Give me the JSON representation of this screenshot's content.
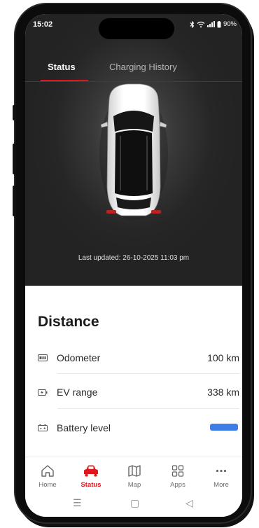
{
  "status_bar": {
    "time": "15:02",
    "battery": "90%"
  },
  "tabs": [
    {
      "label": "Status",
      "active": true
    },
    {
      "label": "Charging History",
      "active": false
    }
  ],
  "car_image": "car-top-view",
  "last_updated": "Last updated: 26-10-2025 11:03 pm",
  "distance": {
    "title": "Distance",
    "rows": [
      {
        "icon": "odometer-icon",
        "label": "Odometer",
        "value": "100 km"
      },
      {
        "icon": "ev-range-icon",
        "label": "EV range",
        "value": "338 km"
      },
      {
        "icon": "battery-icon",
        "label": "Battery level",
        "value": ""
      }
    ]
  },
  "battery_level_fill": 1.0,
  "bottom_nav": [
    {
      "label": "Home",
      "icon": "home-icon",
      "active": false
    },
    {
      "label": "Status",
      "icon": "car-icon",
      "active": true
    },
    {
      "label": "Map",
      "icon": "map-icon",
      "active": false
    },
    {
      "label": "Apps",
      "icon": "apps-icon",
      "active": false
    },
    {
      "label": "More",
      "icon": "more-icon",
      "active": false
    }
  ],
  "colors": {
    "accent": "#e0161f",
    "battery_fill": "#3d7de8",
    "header_bg": "#262626"
  }
}
